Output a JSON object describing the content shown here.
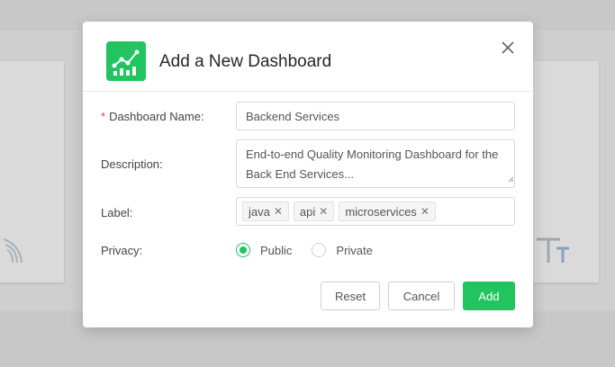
{
  "dialog": {
    "title": "Add a New Dashboard",
    "icon": "chart-line-icon",
    "close_icon": "close-icon"
  },
  "form": {
    "name": {
      "required_mark": "*",
      "label": "Dashboard Name:",
      "value": "Backend Services"
    },
    "description": {
      "label": "Description:",
      "value": "End-to-end Quality Monitoring Dashboard for the Back End Services..."
    },
    "labels": {
      "label": "Label:",
      "tags": [
        "java",
        "api",
        "microservices"
      ]
    },
    "privacy": {
      "label": "Privacy:",
      "options": [
        "Public",
        "Private"
      ],
      "selected": "Public"
    }
  },
  "buttons": {
    "reset": "Reset",
    "cancel": "Cancel",
    "add": "Add"
  },
  "colors": {
    "accent": "#21c45e",
    "required": "#f04134"
  }
}
